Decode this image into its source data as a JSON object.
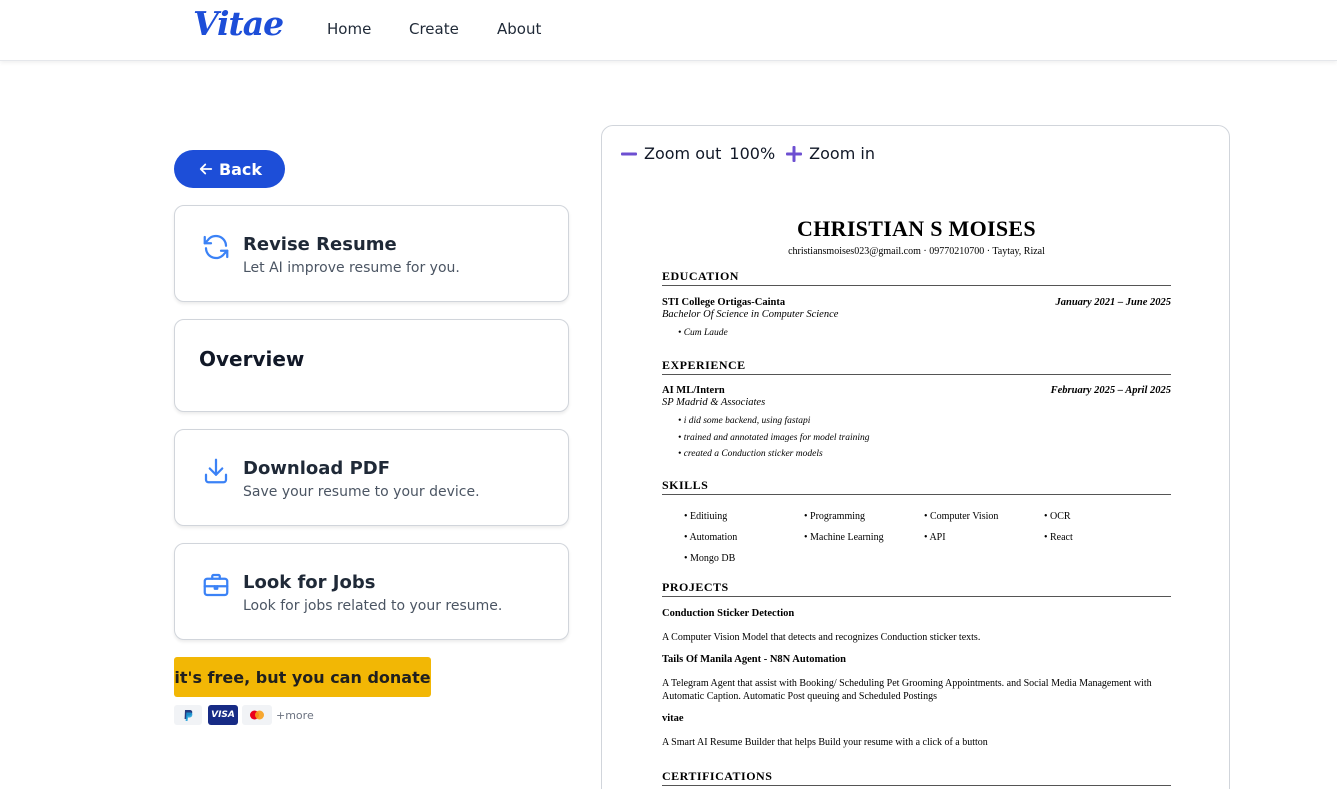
{
  "header": {
    "logo": "Vitae",
    "nav": [
      "Home",
      "Create",
      "About"
    ]
  },
  "left": {
    "back_label": "Back",
    "cards": [
      {
        "title": "Revise Resume",
        "subtitle": "Let AI improve resume for you.",
        "icon": "refresh-icon"
      },
      {
        "title": "Overview"
      },
      {
        "title": "Download PDF",
        "subtitle": "Save your resume to your device.",
        "icon": "download-icon"
      },
      {
        "title": "Look for Jobs",
        "subtitle": "Look for jobs related to your resume.",
        "icon": "briefcase-icon"
      }
    ],
    "donate_label": "it's free, but you can donate",
    "payments": [
      "PayPal",
      "VISA",
      "Mastercard"
    ],
    "more_label": "+more"
  },
  "preview": {
    "zoom_out_label": "Zoom out",
    "zoom_level": "100%",
    "zoom_in_label": "Zoom in"
  },
  "resume": {
    "name": "CHRISTIAN S MOISES",
    "contact": "christiansmoises023@gmail.com · 09770210700 · Taytay, Rizal",
    "sections": {
      "education": "EDUCATION",
      "experience": "EXPERIENCE",
      "skills": "SKILLS",
      "projects": "PROJECTS",
      "certifications": "CERTIFICATIONS"
    },
    "education": {
      "school": "STI College Ortigas-Cainta",
      "dates": "January 2021 – June 2025",
      "degree": "Bachelor Of Science in Computer Science",
      "bullets": [
        "• Cum Laude"
      ]
    },
    "experience": {
      "role": "AI ML/Intern",
      "dates": "February 2025 – April 2025",
      "company": "SP Madrid & Associates",
      "bullets": [
        "• i did some backend, using fastapi",
        "• trained and annotated images for model training",
        "• created a Conduction sticker models"
      ]
    },
    "skills": [
      "• Editiuing",
      "• Programming",
      "• Computer Vision",
      "• OCR",
      "• Automation",
      "• Machine Learning",
      "• API",
      "• React",
      "• Mongo DB"
    ],
    "projects": [
      {
        "title": "Conduction Sticker Detection",
        "desc": "A Computer Vision Model that detects and recognizes Conduction sticker texts."
      },
      {
        "title": "Tails Of Manila Agent - N8N Automation",
        "desc": "A Telegram Agent that assist with Booking/ Scheduling Pet Grooming Appointments. and Social Media Management with Automatic Caption. Automatic Post queuing and Scheduled Postings"
      },
      {
        "title": "vitae",
        "desc": "A Smart AI Resume Builder that helps Build your resume with a click of a button"
      }
    ]
  },
  "colors": {
    "brand": "#1d4ed8",
    "icon_blue": "#3b82f6",
    "donate": "#f2b705",
    "zoom_icon": "#6d4fd1"
  }
}
